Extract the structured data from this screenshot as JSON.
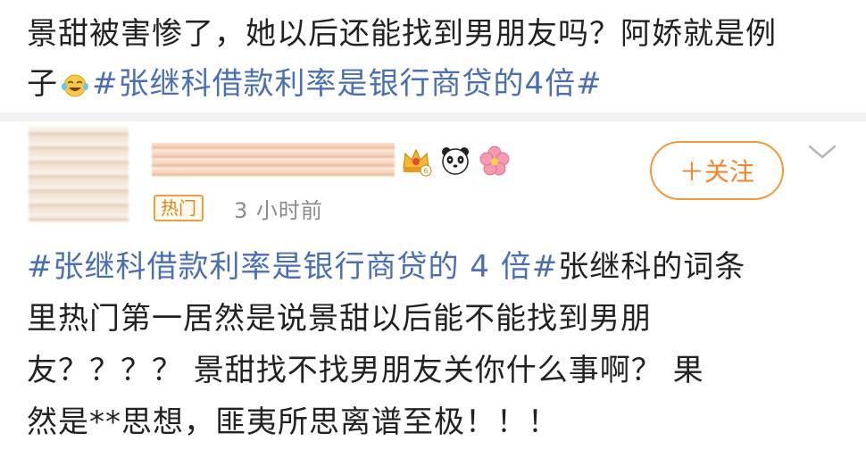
{
  "top_post": {
    "line1": "景甜被害惨了，她以后还能找到男朋友吗？阿娇就是例",
    "line2_prefix": "子",
    "emoji_icon": "laugh-cry-emoji",
    "hashtag": "#张继科借款利率是银行商贷的4倍#"
  },
  "comment": {
    "hot_label": "热门",
    "time": "3 小时前",
    "follow_label": "＋关注",
    "badges": [
      "crown-badge-icon",
      "panda-icon",
      "flower-icon"
    ],
    "hashtag": "#张继科借款利率是银行商贷的 4 倍#",
    "body_l1_rest": "张继科的词条",
    "body_l2": "里热门第一居然是说景甜以后能不能找到男朋",
    "body_l3": "友？？？？ 景甜找不找男朋友关你什么事啊？ 果",
    "body_l4": "然是**思想，匪夷所思离谱至极！！！"
  },
  "colors": {
    "hashtag": "#4a6fb3",
    "follow_border": "#f29a3a",
    "hot_tag": "#e8a23c"
  }
}
